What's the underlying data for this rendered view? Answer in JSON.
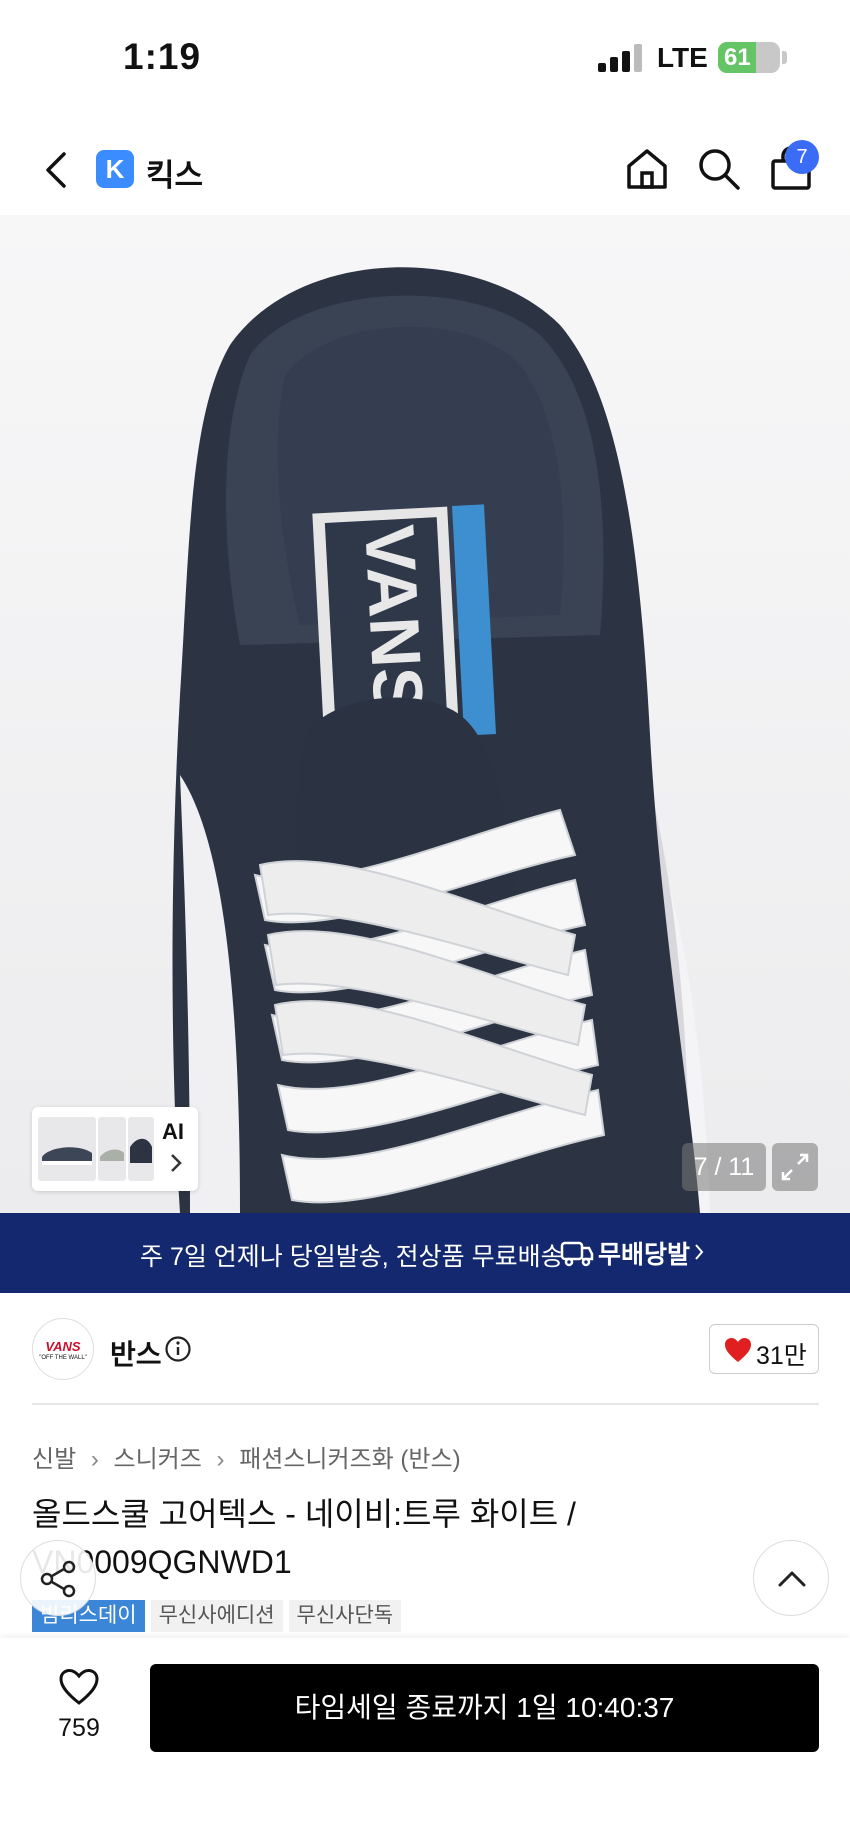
{
  "status_bar": {
    "time": "1:19",
    "network": "LTE",
    "battery": "61",
    "battery_level": 0.61
  },
  "header": {
    "brand_initial": "K",
    "brand_name": "킥스",
    "cart_count": "7",
    "icons": [
      "back-icon",
      "home-icon",
      "search-icon",
      "shopping-bag-icon"
    ]
  },
  "gallery": {
    "current": "7 / 11",
    "ai_label": "AI"
  },
  "banner": {
    "text": "주 7일 언제나 당일발송, 전상품 무료배송",
    "brand": "무배당발"
  },
  "brand": {
    "name": "반스",
    "logo_text": "VANS",
    "logo_sub": "\"OFF THE WALL\"",
    "likes": "31만"
  },
  "breadcrumb": [
    "신발",
    "스니커즈",
    "패션스니커즈화 (반스)"
  ],
  "product": {
    "title": "올드스쿨 고어텍스 - 네이비:트루 화이트 / VN0009QGNWD1"
  },
  "tags": [
    "빔리스데이",
    "무신사에디션",
    "무신사단독"
  ],
  "bottom_bar": {
    "wish_count": "759",
    "buy_label": "타임세일 종료까지 1일 10:40:37"
  },
  "colors": {
    "banner_bg": "#13286e",
    "accent_blue": "#3b86d6",
    "heart_red": "#e02020",
    "badge_blue": "#3b6cf6",
    "battery_green": "#65c466"
  }
}
